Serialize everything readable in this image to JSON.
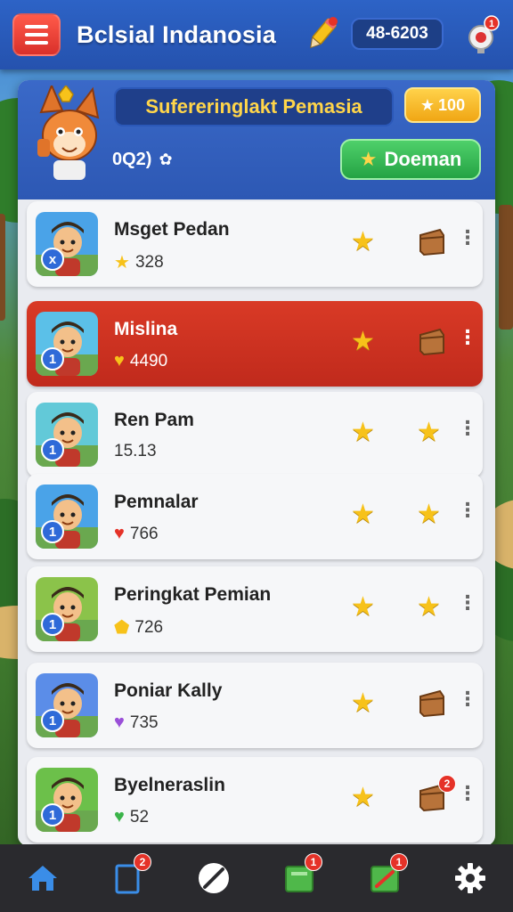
{
  "header": {
    "title": "Bclsial Indanosia",
    "coins": "48-6203",
    "notification_count": "1"
  },
  "panel": {
    "title": "Sufereringlakt Pemasia",
    "star_count": "100",
    "player_id": "0Q2)",
    "download_label": "Doeman"
  },
  "players": [
    {
      "name": "Msget Pedan",
      "score": "328",
      "score_icon": "star",
      "reward": "chest",
      "avatar_color": "#4aa3e8",
      "badge": "x"
    },
    {
      "name": "Mislina",
      "score": "4490",
      "score_icon": "heart-gold",
      "reward": "chest",
      "avatar_color": "#5bc0e8",
      "badge": "1",
      "active": true
    },
    {
      "name": "Ren Pam",
      "score": "15.13",
      "score_icon": "none",
      "reward": "star",
      "avatar_color": "#62c9d8",
      "badge": "1"
    },
    {
      "name": "Pemnalar",
      "score": "766",
      "score_icon": "heart-red",
      "reward": "star",
      "avatar_color": "#4aa3e8",
      "badge": "1"
    },
    {
      "name": "Peringkat Pemian",
      "score": "726",
      "score_icon": "shield-gold",
      "reward": "star",
      "avatar_color": "#8bc34a",
      "badge": "1"
    },
    {
      "name": "Poniar Kally",
      "score": "735",
      "score_icon": "heart-purple",
      "reward": "chest",
      "avatar_color": "#5b8de8",
      "badge": "1"
    },
    {
      "name": "Byelneraslin",
      "score": "52",
      "score_icon": "heart-green",
      "reward": "chest",
      "avatar_color": "#6cc04a",
      "badge": "1",
      "reward_badge": "2"
    }
  ],
  "nav": {
    "items": [
      "home",
      "cards",
      "compass",
      "missions",
      "shop",
      "settings"
    ],
    "badges": {
      "cards": "2",
      "missions": "1",
      "shop": "1"
    }
  },
  "colors": {
    "topbar": "#2d63c6",
    "active_row": "#c82e1e",
    "accent_green": "#25a344",
    "gold": "#f7c21a"
  }
}
